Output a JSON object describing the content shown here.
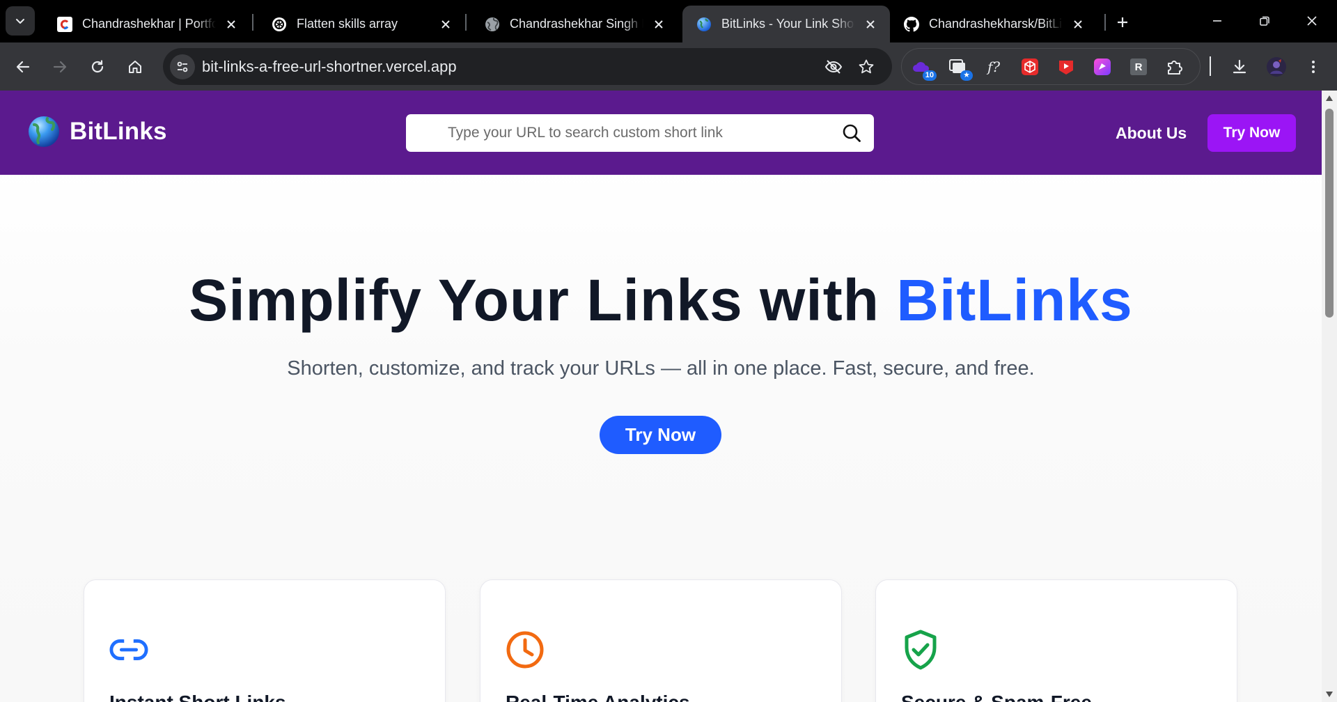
{
  "browser": {
    "tabs": [
      {
        "title": "Chandrashekhar | Portfolio",
        "favicon": "portfolio-c-icon",
        "active": false
      },
      {
        "title": "Flatten skills array",
        "favicon": "chatgpt-icon",
        "active": false
      },
      {
        "title": "Chandrashekhar Singh Kushwah",
        "favicon": "globe-icon",
        "active": false
      },
      {
        "title": "BitLinks - Your Link Shortener",
        "favicon": "globe-blue-icon",
        "active": true
      },
      {
        "title": "Chandrashekharsk/BitLinks",
        "favicon": "github-icon",
        "active": false
      }
    ],
    "address_bar": {
      "url": "bit-links-a-free-url-shortner.vercel.app"
    },
    "extensions": [
      {
        "name": "cloud-extension-icon",
        "badge": "10"
      },
      {
        "name": "window-extension-icon",
        "badge": "★"
      },
      {
        "name": "font-extension-icon",
        "label": "f?"
      },
      {
        "name": "cube-extension-icon"
      },
      {
        "name": "play-extension-icon"
      },
      {
        "name": "gradient-extension-icon"
      },
      {
        "name": "r-extension-icon",
        "label": "R"
      },
      {
        "name": "puzzle-extension-icon"
      }
    ]
  },
  "nav": {
    "brand": "BitLinks",
    "search_placeholder": "Type your URL to search custom short link",
    "about": "About Us",
    "try_now": "Try Now"
  },
  "hero": {
    "title_main": "Simplify Your Links with ",
    "title_accent": "BitLinks",
    "subtitle": "Shorten, customize, and track your URLs — all in one place. Fast, secure, and free.",
    "cta": "Try Now"
  },
  "features": [
    {
      "title": "Instant Short Links",
      "icon": "link-icon",
      "color": "#1f6fff"
    },
    {
      "title": "Real-Time Analytics",
      "icon": "clock-icon",
      "color": "#f26a11"
    },
    {
      "title": "Secure & Spam-Free",
      "icon": "shield-check-icon",
      "color": "#16a34a"
    }
  ],
  "colors": {
    "nav_bg": "#5b1a8e",
    "accent_blue": "#1f5cff",
    "try_button": "#9b15f5"
  }
}
